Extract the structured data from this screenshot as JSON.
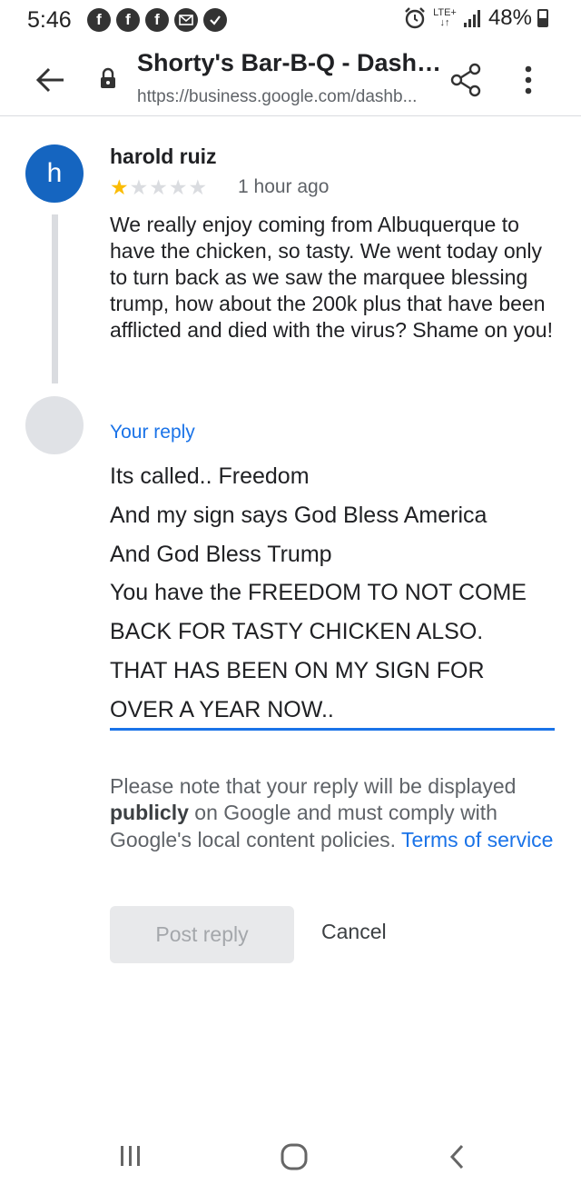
{
  "status_bar": {
    "time": "5:46",
    "notification_icons": [
      "facebook-icon",
      "facebook-icon",
      "facebook-icon",
      "mail-icon",
      "check-icon"
    ],
    "network": "LTE+",
    "battery": "48%"
  },
  "toolbar": {
    "title": "Shorty's Bar-B-Q - Dashbo...",
    "url": "https://business.google.com/dashb..."
  },
  "review": {
    "avatar_letter": "h",
    "avatar_color": "#1565c0",
    "reviewer_name": "harold ruiz",
    "rating": 1,
    "rating_max": 5,
    "time": "1 hour ago",
    "text": "We really enjoy coming from Albuquerque to have the chicken, so tasty. We went today only to turn back as we saw the marquee blessing trump, how about the 200k plus that have been afflicted and died with the virus? Shame on you!"
  },
  "reply": {
    "label": "Your reply",
    "lines": [
      "Its called.. Freedom",
      "And my sign says God Bless  America",
      "And God Bless Trump",
      "You have the FREEDOM TO NOT COME",
      "BACK FOR TASTY CHICKEN ALSO.",
      "THAT HAS BEEN ON MY SIGN FOR",
      "OVER A YEAR NOW.."
    ],
    "accent_color": "#1a73e8"
  },
  "policy": {
    "prefix": "Please note that your reply will be displayed ",
    "bold": "publicly",
    "middle": " on Google and must comply with Google's local content policies. ",
    "link": "Terms of service"
  },
  "actions": {
    "post_reply": "Post reply",
    "cancel": "Cancel"
  },
  "nav_bar": {
    "icons": [
      "recent-apps-icon",
      "home-icon",
      "back-icon"
    ]
  }
}
